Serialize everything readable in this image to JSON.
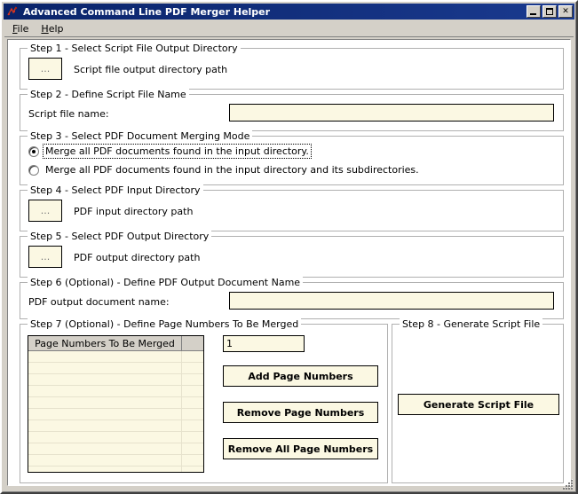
{
  "window": {
    "title": "Advanced Command Line PDF Merger Helper",
    "icon": "app-icon",
    "buttons": {
      "minimize": "minimize",
      "maximize": "maximize",
      "close": "close"
    }
  },
  "menubar": {
    "items": [
      {
        "label": "File",
        "mnemonic": "F"
      },
      {
        "label": "Help",
        "mnemonic": "H"
      }
    ]
  },
  "steps": {
    "step1": {
      "legend": "Step 1 - Select Script File Output Directory",
      "browse_label": "...",
      "path_label": "Script file output directory path"
    },
    "step2": {
      "legend": "Step 2 - Define Script File Name",
      "field_label": "Script file name:",
      "field_value": "",
      "field_placeholder": ""
    },
    "step3": {
      "legend": "Step 3 - Select PDF Document Merging Mode",
      "options": [
        {
          "label": "Merge all PDF documents found in the input directory.",
          "checked": true,
          "focused": true
        },
        {
          "label": "Merge all PDF documents found in the input directory and its subdirectories.",
          "checked": false,
          "focused": false
        }
      ]
    },
    "step4": {
      "legend": "Step 4 - Select PDF Input Directory",
      "browse_label": "...",
      "path_label": "PDF input directory path"
    },
    "step5": {
      "legend": "Step 5 - Select PDF Output Directory",
      "browse_label": "...",
      "path_label": "PDF output directory path"
    },
    "step6": {
      "legend": "Step 6 (Optional) - Define PDF Output Document Name",
      "field_label": "PDF output document name:",
      "field_value": "",
      "field_placeholder": ""
    },
    "step7": {
      "legend": "Step 7 (Optional) - Define Page Numbers To Be Merged",
      "list_header": "Page Numbers To Be Merged",
      "list_header_extra": "",
      "list_rows": [
        "",
        "",
        "",
        "",
        "",
        "",
        "",
        "",
        "",
        "",
        ""
      ],
      "page_number_value": "1",
      "add_button": "Add Page Numbers",
      "remove_button": "Remove Page Numbers",
      "remove_all_button": "Remove All Page Numbers"
    },
    "step8": {
      "legend": "Step 8 - Generate Script File",
      "generate_button": "Generate Script File"
    }
  },
  "colors": {
    "titlebar": "#0a246a",
    "face": "#d4d0c8",
    "panel": "#ffffff",
    "field": "#fbf8e3",
    "border": "#000000",
    "group_border": "#b0b0b0"
  }
}
